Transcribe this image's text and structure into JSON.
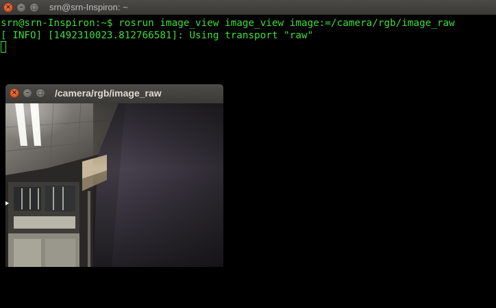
{
  "terminal": {
    "title": "srn@srn-Inspiron: ~",
    "lines": {
      "command": "srn@srn-Inspiron:~$ rosrun image_view image_view image:=/camera/rgb/image_raw",
      "info": "[ INFO] [1492310023.812766581]: Using transport \"raw\""
    },
    "text_color": "#3fde3a"
  },
  "image_window": {
    "title": "/camera/rgb/image_raw",
    "image_description_icon": "camera-feed-image"
  },
  "window_buttons": {
    "close_glyph": "×",
    "minimize_glyph": "–",
    "maximize_glyph": "□"
  }
}
